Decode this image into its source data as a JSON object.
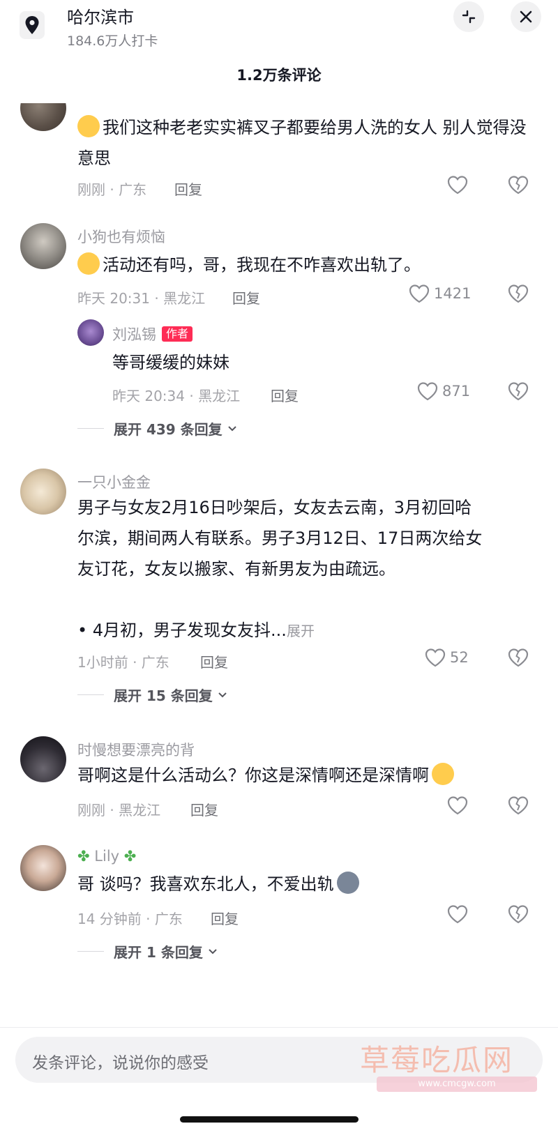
{
  "header": {
    "location_title": "哈尔滨市",
    "location_sub": "184.6万人打卡",
    "comment_count_title": "1.2万条评论"
  },
  "comments": [
    {
      "username": "",
      "text": "我们这种老老实实裤叉子都要给男人洗的女人 别人觉得没意思",
      "meta": "刚刚 · 广东",
      "reply": "回复",
      "likes": ""
    },
    {
      "username": "小狗也有烦恼",
      "text": "活动还有吗，哥，我现在不咋喜欢出轨了。",
      "meta": "昨天 20:31 · 黑龙江",
      "reply": "回复",
      "likes": "1421",
      "sub_reply": {
        "username": "刘泓锡",
        "badge": "作者",
        "text": "等哥缓缓的妹妹",
        "meta": "昨天 20:34 · 黑龙江",
        "reply": "回复",
        "likes": "871"
      },
      "expand": "展开 439 条回复"
    },
    {
      "username": "一只小金金",
      "text_lines": [
        "男子与女友2月16日吵架后，女友去云南，3月初回哈",
        "尔滨，期间两人有联系。男子3月12日、17日两次给女",
        "友订花，女友以搬家、有新男友为由疏远。"
      ],
      "text_tail": "• 4月初，男子发现女友抖...",
      "more_label": "展开",
      "meta": "1小时前 · 广东",
      "reply": "回复",
      "likes": "52",
      "expand": "展开 15 条回复"
    },
    {
      "username": "时慢想要漂亮的背",
      "text": "哥啊这是什么活动么？你这是深情啊还是深情啊",
      "meta": "刚刚 · 黑龙江",
      "reply": "回复",
      "likes": ""
    },
    {
      "username": "Lily",
      "text": "哥 谈吗？我喜欢东北人，不爱出轨",
      "meta": "14 分钟前 · 广东",
      "reply": "回复",
      "likes": "",
      "expand": "展开 1 条回复"
    }
  ],
  "input": {
    "placeholder": "发条评论，说说你的感受"
  },
  "watermark": {
    "text": "草莓吃瓜网",
    "url": "www.cmcgw.com"
  },
  "colors": {
    "author_badge": "#fe2c55",
    "muted_text": "#9a9aa0",
    "primary_text": "#161823"
  }
}
